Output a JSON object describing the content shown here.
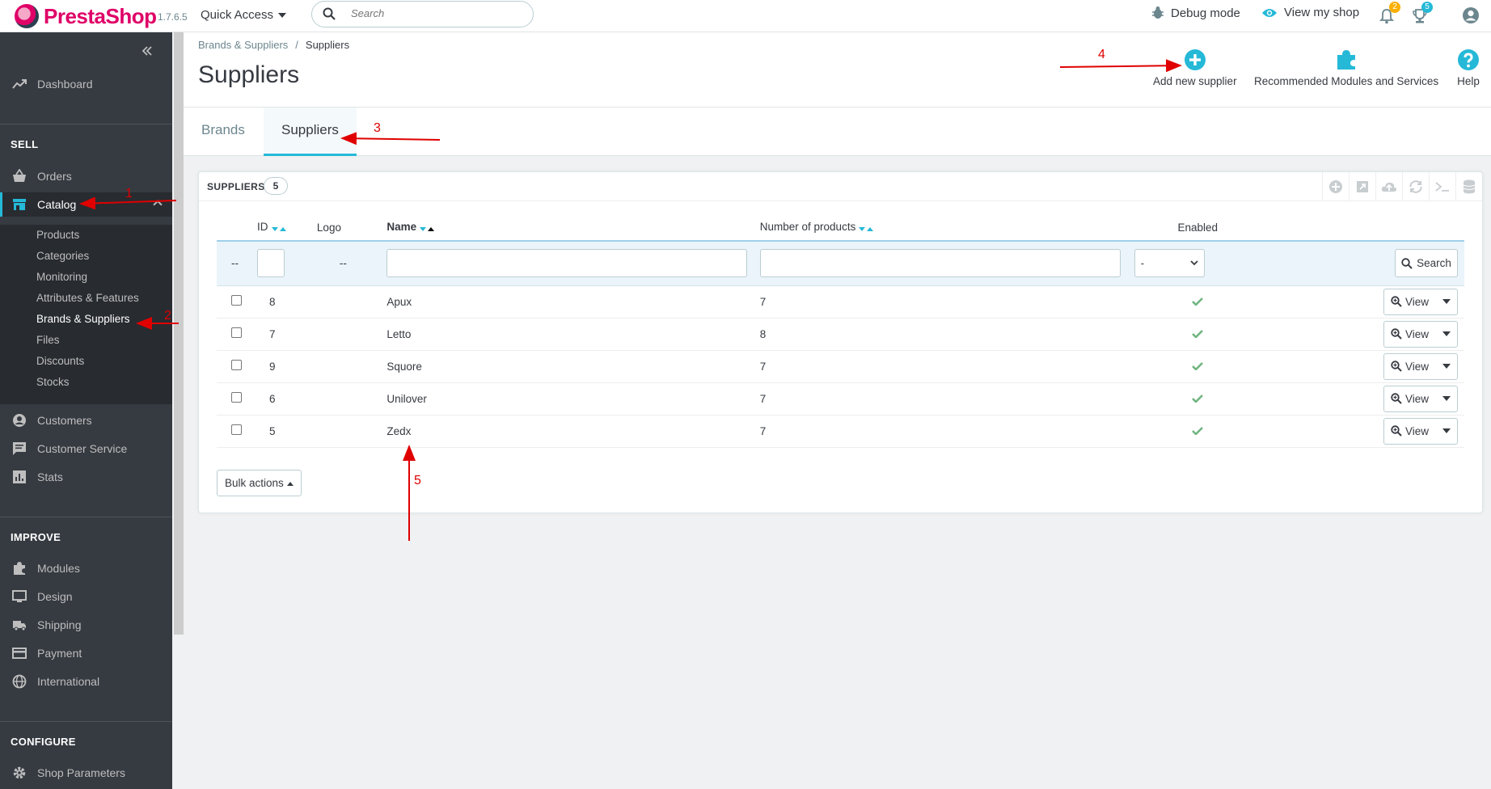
{
  "header": {
    "brand": "PrestaShop",
    "version": "1.7.6.5",
    "quick_access": "Quick Access",
    "search_placeholder": "Search",
    "debug_mode": "Debug mode",
    "view_shop": "View my shop",
    "notifications_count": "2",
    "trophy_count": "5"
  },
  "sidebar": {
    "dashboard": "Dashboard",
    "sell": "SELL",
    "orders": "Orders",
    "catalog": "Catalog",
    "catalog_sub": [
      "Products",
      "Categories",
      "Monitoring",
      "Attributes & Features",
      "Brands & Suppliers",
      "Files",
      "Discounts",
      "Stocks"
    ],
    "customers": "Customers",
    "customer_service": "Customer Service",
    "stats": "Stats",
    "improve": "IMPROVE",
    "modules": "Modules",
    "design": "Design",
    "shipping": "Shipping",
    "payment": "Payment",
    "international": "International",
    "configure": "CONFIGURE",
    "shop_parameters": "Shop Parameters"
  },
  "page": {
    "breadcrumb_parent": "Brands & Suppliers",
    "breadcrumb_sep": "/",
    "breadcrumb_current": "Suppliers",
    "title": "Suppliers",
    "add_new": "Add new supplier",
    "recommended": "Recommended Modules and Services",
    "help": "Help"
  },
  "tabs": {
    "brands": "Brands",
    "suppliers": "Suppliers"
  },
  "panel": {
    "title": "SUPPLIERS",
    "count": "5",
    "columns": {
      "id": "ID",
      "logo": "Logo",
      "name": "Name",
      "products": "Number of products",
      "enabled": "Enabled"
    },
    "filter_dash": "--",
    "filter_select": "-",
    "search_btn": "Search",
    "view_btn": "View",
    "bulk": "Bulk actions",
    "rows": [
      {
        "id": "8",
        "name": "Apux",
        "products": "7"
      },
      {
        "id": "7",
        "name": "Letto",
        "products": "8"
      },
      {
        "id": "9",
        "name": "Squore",
        "products": "7"
      },
      {
        "id": "6",
        "name": "Unilover",
        "products": "7"
      },
      {
        "id": "5",
        "name": "Zedx",
        "products": "7"
      }
    ]
  },
  "annotations": [
    "1",
    "2",
    "3",
    "4",
    "5"
  ],
  "colors": {
    "accent": "#25b9d7",
    "brand": "#df0067",
    "sidebar": "#363a41",
    "annotation": "#e00000",
    "enabled": "#70b580"
  }
}
